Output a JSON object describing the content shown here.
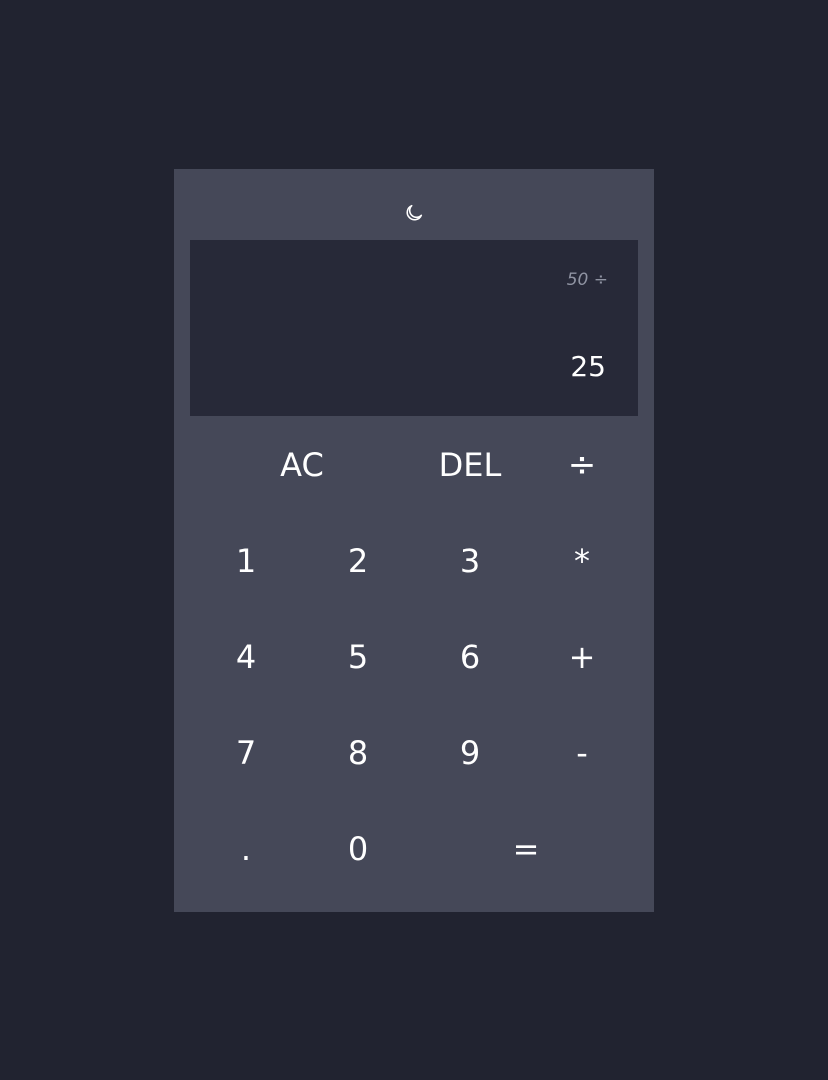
{
  "theme_toggle": {
    "icon": "moon-icon"
  },
  "display": {
    "previous": "50 ÷",
    "current": "25"
  },
  "keys": {
    "clear": "AC",
    "delete": "DEL",
    "divide": "÷",
    "one": "1",
    "two": "2",
    "three": "3",
    "multiply": "*",
    "four": "4",
    "five": "5",
    "six": "6",
    "add": "+",
    "seven": "7",
    "eight": "8",
    "nine": "9",
    "subtract": "-",
    "decimal": ".",
    "zero": "0",
    "equals": "="
  },
  "colors": {
    "page_background": "#212330",
    "calculator_background": "#454858",
    "display_background": "#272938",
    "text": "#ffffff",
    "muted_text": "#8f93a2"
  }
}
